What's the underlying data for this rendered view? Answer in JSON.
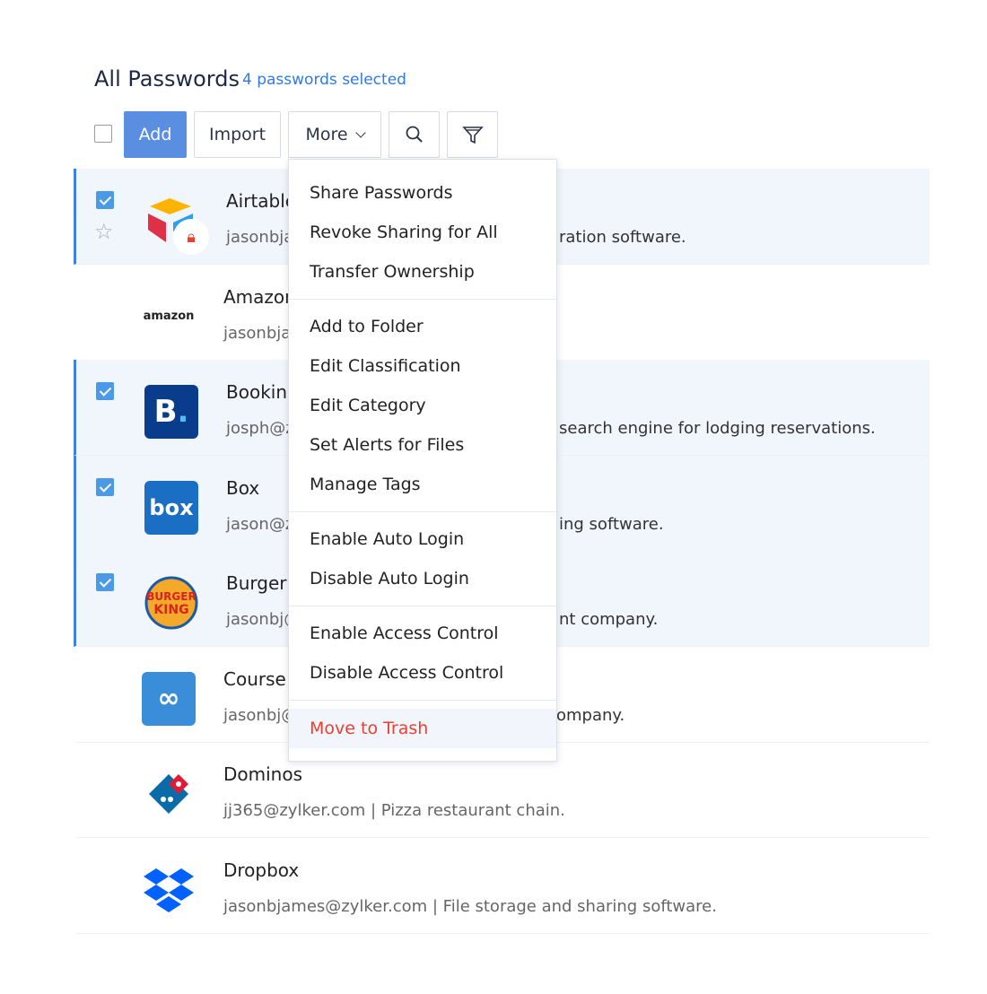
{
  "header": {
    "title": "All Passwords",
    "selection": "4 passwords selected"
  },
  "toolbar": {
    "add": "Add",
    "import": "Import",
    "more": "More",
    "search_icon": "search-icon",
    "filter_icon": "filter-icon"
  },
  "colors": {
    "accent": "#5a8ee0",
    "danger": "#e8412f",
    "selected_row": "#f1f5fc"
  },
  "rows": [
    {
      "name": "Airtable",
      "sub_left": "jasonbja",
      "sub_right": "ration software.",
      "selected": true
    },
    {
      "name": "Amazon",
      "sub_left": "jasonbja",
      "sub_right": "",
      "selected": false,
      "logo": "amazon"
    },
    {
      "name": "Booking",
      "sub_left": "josph@z",
      "sub_right": "search engine for lodging reservations.",
      "selected": true,
      "logo": "B."
    },
    {
      "name": "Box",
      "sub_left": "jason@z",
      "sub_right": "ing software.",
      "selected": true,
      "logo": "box"
    },
    {
      "name": "Burger",
      "sub_left": "jasonbj@",
      "sub_right": "nt company.",
      "selected": true,
      "logo": "BURGER KING"
    },
    {
      "name": "Course",
      "sub_left": "jasonbj@",
      "sub_right": "ompany.",
      "selected": false
    },
    {
      "name": "Dominos",
      "sub_left": "jj365@zylker.com | Pizza restaurant chain.",
      "sub_right": "",
      "selected": false
    },
    {
      "name": "Dropbox",
      "sub_left": "jasonbjames@zylker.com | File storage and sharing software.",
      "sub_right": "",
      "selected": false
    }
  ],
  "menu": {
    "items": [
      "Share Passwords",
      "Revoke Sharing for All",
      "Transfer Ownership",
      "Add to Folder",
      "Edit Classification",
      "Edit Category",
      "Set Alerts for Files",
      "Manage Tags",
      "Enable Auto Login",
      "Disable Auto Login",
      "Enable Access Control",
      "Disable Access Control",
      "Move to Trash"
    ]
  }
}
